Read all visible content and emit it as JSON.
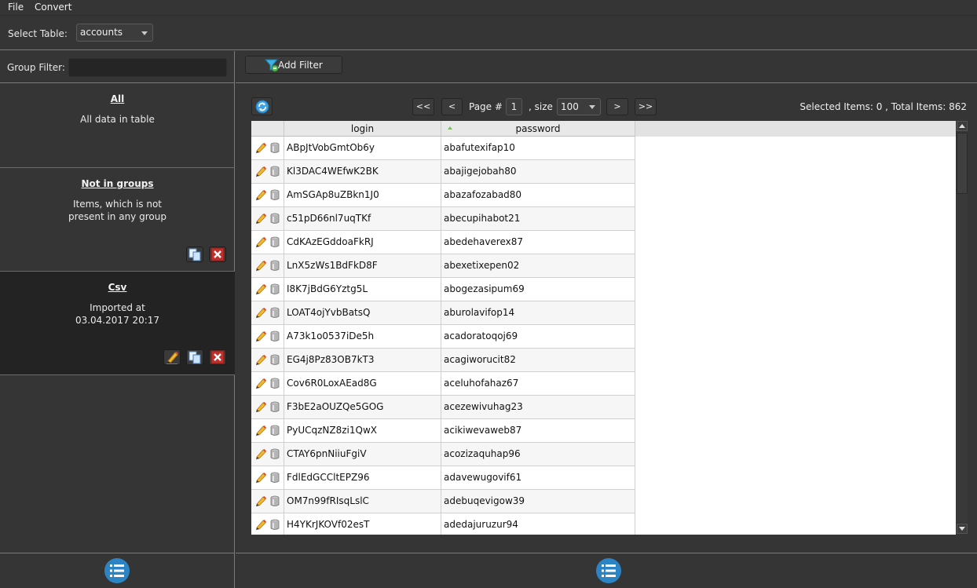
{
  "menu": {
    "file": "File",
    "convert": "Convert"
  },
  "table_select": {
    "label": "Select Table:",
    "value": "accounts"
  },
  "group_filter": {
    "label": "Group Filter:",
    "value": ""
  },
  "groups": [
    {
      "title": "All",
      "description": "All data in table"
    },
    {
      "title": "Not in groups",
      "description": "Items, which is not\npresent in any group"
    },
    {
      "title": "Csv",
      "description": "Imported at\n03.04.2017 20:17"
    }
  ],
  "toolbar": {
    "add_filter": "Add Filter"
  },
  "pager": {
    "first": "<<",
    "prev": "<",
    "page_label": "Page #",
    "page": "1",
    "size_label": ", size",
    "size": "100",
    "next": ">",
    "last": ">>"
  },
  "status": {
    "selected_label": "Selected Items:",
    "selected": "0",
    "total_label": ", Total Items:",
    "total": "862"
  },
  "grid": {
    "columns": [
      "login",
      "password"
    ],
    "sorted_column": "password",
    "rows": [
      {
        "login": "ABpJtVobGmtOb6y",
        "password": "abafutexifap10"
      },
      {
        "login": "Kl3DAC4WEfwK2BK",
        "password": "abajigejobah80"
      },
      {
        "login": "AmSGAp8uZBkn1J0",
        "password": "abazafozabad80"
      },
      {
        "login": "c51pD66nl7uqTKf",
        "password": "abecupihabot21"
      },
      {
        "login": "CdKAzEGddoaFkRJ",
        "password": "abedehaverex87"
      },
      {
        "login": "LnX5zWs1BdFkD8F",
        "password": "abexetixepen02"
      },
      {
        "login": "I8K7jBdG6Yztg5L",
        "password": "abogezasipum69"
      },
      {
        "login": "LOAT4ojYvbBatsQ",
        "password": "aburolavifop14"
      },
      {
        "login": "A73k1o0537iDe5h",
        "password": "acadoratoqoj69"
      },
      {
        "login": "EG4j8Pz83OB7kT3",
        "password": "acagiworucit82"
      },
      {
        "login": "Cov6R0LoxAEad8G",
        "password": "aceluhofahaz67"
      },
      {
        "login": "F3bE2aOUZQe5GOG",
        "password": "acezewivuhag23"
      },
      {
        "login": "PyUCqzNZ8zi1QwX",
        "password": "acikiwevaweb87"
      },
      {
        "login": "CTAY6pnNiiuFgiV",
        "password": "acozizaquhap96"
      },
      {
        "login": "FdlEdGCCltEPZ96",
        "password": "adavewugovif61"
      },
      {
        "login": "OM7n99fRIsqLslC",
        "password": "adebuqevigow39"
      },
      {
        "login": "H4YKrJKOVf02esT",
        "password": "adedajuruzur94"
      }
    ]
  }
}
